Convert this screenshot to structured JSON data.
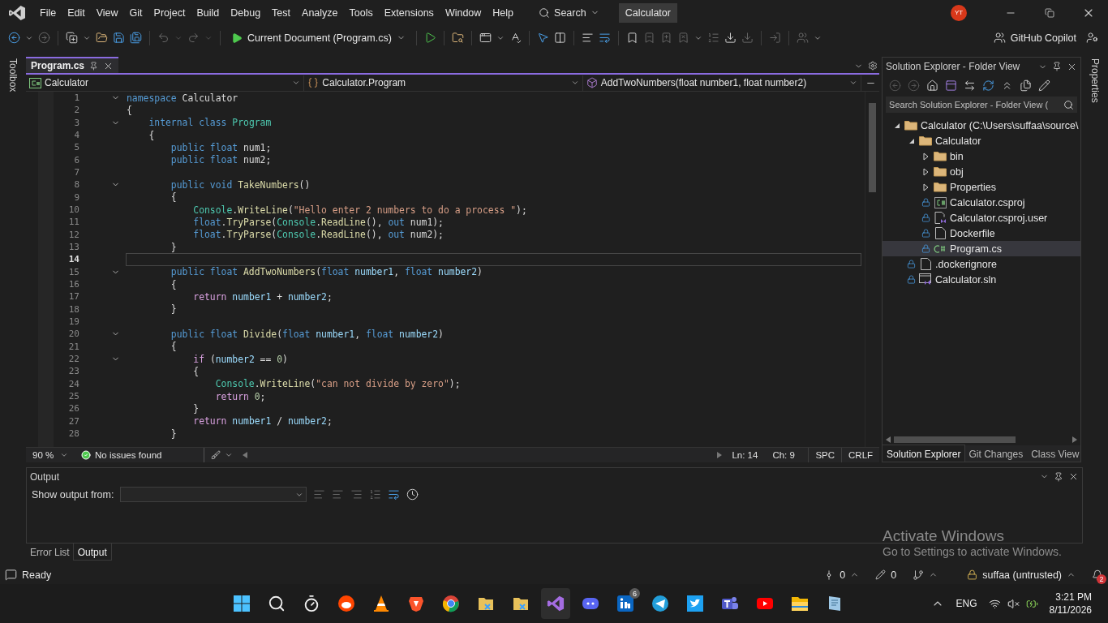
{
  "menu": [
    "File",
    "Edit",
    "View",
    "Git",
    "Project",
    "Build",
    "Debug",
    "Test",
    "Analyze",
    "Tools",
    "Extensions",
    "Window",
    "Help"
  ],
  "search": {
    "label": "Search"
  },
  "solution_name": "Calculator",
  "account": {
    "initials": "YT"
  },
  "toolbar": {
    "run_target": "Current Document (Program.cs)",
    "copilot": "GitHub Copilot"
  },
  "toolbox": "Toolbox",
  "properties": "Properties",
  "editor": {
    "tabs": [
      {
        "label": "Program.cs",
        "selected": true
      }
    ],
    "nav": [
      {
        "kind": "project",
        "label": "Calculator"
      },
      {
        "kind": "class",
        "label": "Calculator.Program"
      },
      {
        "kind": "method",
        "label": "AddTwoNumbers(float number1, float number2)"
      }
    ],
    "lines": [
      {
        "number": "1",
        "fold": true,
        "current": false,
        "tokens": [
          {
            "kind": "kw",
            "text": "namespace "
          },
          {
            "kind": "plain",
            "text": "Calculator"
          }
        ]
      },
      {
        "number": "2",
        "fold": false,
        "current": false,
        "tokens": [
          {
            "kind": "plain",
            "text": "{"
          }
        ]
      },
      {
        "number": "3",
        "fold": true,
        "current": false,
        "tokens": [
          {
            "kind": "kw",
            "text": "    internal class "
          },
          {
            "kind": "cls",
            "text": "Program"
          }
        ]
      },
      {
        "number": "4",
        "fold": false,
        "current": false,
        "tokens": [
          {
            "kind": "plain",
            "text": "    {"
          }
        ]
      },
      {
        "number": "5",
        "fold": false,
        "current": false,
        "tokens": [
          {
            "kind": "kw",
            "text": "        public float "
          },
          {
            "kind": "plain",
            "text": "num1;"
          }
        ]
      },
      {
        "number": "6",
        "fold": false,
        "current": false,
        "tokens": [
          {
            "kind": "kw",
            "text": "        public float "
          },
          {
            "kind": "plain",
            "text": "num2;"
          }
        ]
      },
      {
        "number": "7",
        "fold": false,
        "current": false
      },
      {
        "number": "8",
        "fold": true,
        "current": false,
        "tokens": [
          {
            "kind": "kw",
            "text": "        public void "
          },
          {
            "kind": "method",
            "text": "TakeNumbers"
          },
          {
            "kind": "plain",
            "text": "()"
          }
        ]
      },
      {
        "number": "9",
        "fold": false,
        "current": false,
        "tokens": [
          {
            "kind": "plain",
            "text": "        {"
          }
        ]
      },
      {
        "number": "10",
        "fold": false,
        "current": false,
        "tokens": [
          {
            "kind": "cls",
            "text": "            Console"
          },
          {
            "kind": "plain",
            "text": "."
          },
          {
            "kind": "method",
            "text": "WriteLine"
          },
          {
            "kind": "plain",
            "text": "("
          },
          {
            "kind": "str",
            "text": "\"Hello enter 2 numbers to do a process \""
          },
          {
            "kind": "plain",
            "text": ");"
          }
        ]
      },
      {
        "number": "11",
        "fold": false,
        "current": false,
        "tokens": [
          {
            "kind": "kw",
            "text": "            float"
          },
          {
            "kind": "plain",
            "text": "."
          },
          {
            "kind": "method",
            "text": "TryParse"
          },
          {
            "kind": "plain",
            "text": "("
          },
          {
            "kind": "cls",
            "text": "Console"
          },
          {
            "kind": "plain",
            "text": "."
          },
          {
            "kind": "method",
            "text": "ReadLine"
          },
          {
            "kind": "plain",
            "text": "(), "
          },
          {
            "kind": "kw",
            "text": "out "
          },
          {
            "kind": "plain",
            "text": "num1);"
          }
        ]
      },
      {
        "number": "12",
        "fold": false,
        "current": false,
        "tokens": [
          {
            "kind": "kw",
            "text": "            float"
          },
          {
            "kind": "plain",
            "text": "."
          },
          {
            "kind": "method",
            "text": "TryParse"
          },
          {
            "kind": "plain",
            "text": "("
          },
          {
            "kind": "cls",
            "text": "Console"
          },
          {
            "kind": "plain",
            "text": "."
          },
          {
            "kind": "method",
            "text": "ReadLine"
          },
          {
            "kind": "plain",
            "text": "(), "
          },
          {
            "kind": "kw",
            "text": "out "
          },
          {
            "kind": "plain",
            "text": "num2);"
          }
        ]
      },
      {
        "number": "13",
        "fold": false,
        "current": false,
        "tokens": [
          {
            "kind": "plain",
            "text": "        }"
          }
        ]
      },
      {
        "number": "14",
        "fold": false,
        "current": true
      },
      {
        "number": "15",
        "fold": true,
        "current": false,
        "tokens": [
          {
            "kind": "kw",
            "text": "        public float "
          },
          {
            "kind": "method",
            "text": "AddTwoNumbers"
          },
          {
            "kind": "plain",
            "text": "("
          },
          {
            "kind": "kw",
            "text": "float "
          },
          {
            "kind": "var",
            "text": "number1"
          },
          {
            "kind": "plain",
            "text": ", "
          },
          {
            "kind": "kw",
            "text": "float "
          },
          {
            "kind": "var",
            "text": "number2"
          },
          {
            "kind": "plain",
            "text": ")"
          }
        ]
      },
      {
        "number": "16",
        "fold": false,
        "current": false,
        "tokens": [
          {
            "kind": "plain",
            "text": "        {"
          }
        ]
      },
      {
        "number": "17",
        "fold": false,
        "current": false,
        "tokens": [
          {
            "kind": "ctrl",
            "text": "            return "
          },
          {
            "kind": "var",
            "text": "number1"
          },
          {
            "kind": "plain",
            "text": " + "
          },
          {
            "kind": "var",
            "text": "number2"
          },
          {
            "kind": "plain",
            "text": ";"
          }
        ]
      },
      {
        "number": "18",
        "fold": false,
        "current": false,
        "tokens": [
          {
            "kind": "plain",
            "text": "        }"
          }
        ]
      },
      {
        "number": "19",
        "fold": false,
        "current": false
      },
      {
        "number": "20",
        "fold": true,
        "current": false,
        "tokens": [
          {
            "kind": "kw",
            "text": "        public float "
          },
          {
            "kind": "method",
            "text": "Divide"
          },
          {
            "kind": "plain",
            "text": "("
          },
          {
            "kind": "kw",
            "text": "float "
          },
          {
            "kind": "var",
            "text": "number1"
          },
          {
            "kind": "plain",
            "text": ", "
          },
          {
            "kind": "kw",
            "text": "float "
          },
          {
            "kind": "var",
            "text": "number2"
          },
          {
            "kind": "plain",
            "text": ")"
          }
        ]
      },
      {
        "number": "21",
        "fold": false,
        "current": false,
        "tokens": [
          {
            "kind": "plain",
            "text": "        {"
          }
        ]
      },
      {
        "number": "22",
        "fold": true,
        "current": false,
        "tokens": [
          {
            "kind": "ctrl",
            "text": "            if "
          },
          {
            "kind": "plain",
            "text": "("
          },
          {
            "kind": "var",
            "text": "number2"
          },
          {
            "kind": "plain",
            "text": " == "
          },
          {
            "kind": "num",
            "text": "0"
          },
          {
            "kind": "plain",
            "text": ")"
          }
        ]
      },
      {
        "number": "23",
        "fold": false,
        "current": false,
        "tokens": [
          {
            "kind": "plain",
            "text": "            {"
          }
        ]
      },
      {
        "number": "24",
        "fold": false,
        "current": false,
        "tokens": [
          {
            "kind": "cls",
            "text": "                Console"
          },
          {
            "kind": "plain",
            "text": "."
          },
          {
            "kind": "method",
            "text": "WriteLine"
          },
          {
            "kind": "plain",
            "text": "("
          },
          {
            "kind": "str",
            "text": "\"can not divide by zero\""
          },
          {
            "kind": "plain",
            "text": ");"
          }
        ]
      },
      {
        "number": "25",
        "fold": false,
        "current": false,
        "tokens": [
          {
            "kind": "ctrl",
            "text": "                return "
          },
          {
            "kind": "num",
            "text": "0"
          },
          {
            "kind": "plain",
            "text": ";"
          }
        ]
      },
      {
        "number": "26",
        "fold": false,
        "current": false,
        "tokens": [
          {
            "kind": "plain",
            "text": "            }"
          }
        ]
      },
      {
        "number": "27",
        "fold": false,
        "current": false,
        "tokens": [
          {
            "kind": "ctrl",
            "text": "            return "
          },
          {
            "kind": "var",
            "text": "number1"
          },
          {
            "kind": "plain",
            "text": " / "
          },
          {
            "kind": "var",
            "text": "number2"
          },
          {
            "kind": "plain",
            "text": ";"
          }
        ]
      },
      {
        "number": "28",
        "fold": false,
        "current": false,
        "tokens": [
          {
            "kind": "plain",
            "text": "        }"
          }
        ]
      }
    ],
    "status": {
      "zoom": "90 %",
      "issues": "No issues found",
      "line": "Ln: 14",
      "column": "Ch: 9",
      "indent": "SPC",
      "line_ending": "CRLF"
    }
  },
  "solution_explorer": {
    "title": "Solution Explorer - Folder View",
    "search_placeholder": "Search Solution Explorer - Folder View (",
    "tree": [
      {
        "label": "Calculator (C:\\Users\\suffaa\\source\\",
        "kind": "folder",
        "expanded": true,
        "selected": false,
        "children": [
          {
            "label": "Calculator",
            "kind": "folder",
            "expanded": true,
            "selected": false,
            "children": [
              {
                "label": "bin",
                "kind": "folder",
                "expanded": false,
                "selected": false
              },
              {
                "label": "obj",
                "kind": "folder",
                "expanded": false,
                "selected": false
              },
              {
                "label": "Properties",
                "kind": "folder",
                "expanded": false,
                "selected": false
              },
              {
                "label": "Calculator.csproj",
                "kind": "csproj",
                "selected": false
              },
              {
                "label": "Calculator.csproj.user",
                "kind": "user",
                "selected": false
              },
              {
                "label": "Dockerfile",
                "kind": "file",
                "selected": false
              },
              {
                "label": "Program.cs",
                "kind": "cs",
                "selected": true
              }
            ]
          },
          {
            "label": ".dockerignore",
            "kind": "file",
            "selected": false
          },
          {
            "label": "Calculator.sln",
            "kind": "sln",
            "selected": false
          }
        ]
      }
    ],
    "tabs": [
      {
        "label": "Solution Explorer",
        "selected": true
      },
      {
        "label": "Git Changes",
        "selected": false
      },
      {
        "label": "Class View",
        "selected": false
      }
    ]
  },
  "output": {
    "title": "Output",
    "source_label": "Show output from:",
    "tabs": [
      {
        "label": "Error List",
        "selected": false
      },
      {
        "label": "Output",
        "selected": true
      }
    ]
  },
  "activation": {
    "title": "Activate Windows",
    "text": "Go to Settings to activate Windows."
  },
  "status_bar": {
    "state": "Ready",
    "commits": "0",
    "changes": "0",
    "repo": "suffaa (untrusted)",
    "notifications": "2"
  },
  "taskbar": {
    "linkedin_badge": "6",
    "language": "ENG",
    "time": "3:21 PM",
    "date": "8/11/2026"
  }
}
